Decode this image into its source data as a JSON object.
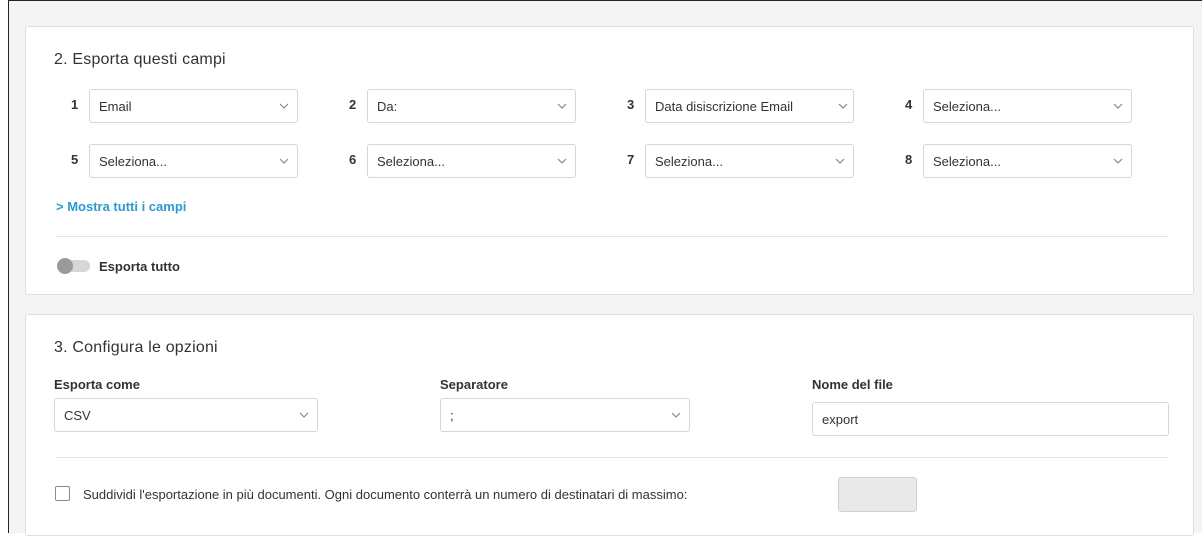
{
  "export_fields": {
    "title": "2. Esporta questi campi",
    "fields": [
      {
        "num": "1",
        "value": "Email"
      },
      {
        "num": "2",
        "value": "Da:"
      },
      {
        "num": "3",
        "value": "Data disiscrizione Email"
      },
      {
        "num": "4",
        "value": "Seleziona..."
      },
      {
        "num": "5",
        "value": "Seleziona..."
      },
      {
        "num": "6",
        "value": "Seleziona..."
      },
      {
        "num": "7",
        "value": "Seleziona..."
      },
      {
        "num": "8",
        "value": "Seleziona..."
      }
    ],
    "show_all_link": "> Mostra tutti i campi",
    "export_all_label": "Esporta tutto",
    "export_all_enabled": false
  },
  "options": {
    "title": "3. Configura le opzioni",
    "export_as": {
      "label": "Esporta come",
      "value": "CSV"
    },
    "separator": {
      "label": "Separatore",
      "value": ";"
    },
    "filename": {
      "label": "Nome del file",
      "value": "export"
    },
    "split_checkbox": {
      "checked": false,
      "label": "Suddividi l'esportazione in più documenti. Ogni documento conterrà un numero di destinatari di massimo:"
    },
    "max_recipients_value": ""
  },
  "colors": {
    "link": "#2c9ad1",
    "background": "#f4f4f4",
    "card": "#ffffff"
  }
}
